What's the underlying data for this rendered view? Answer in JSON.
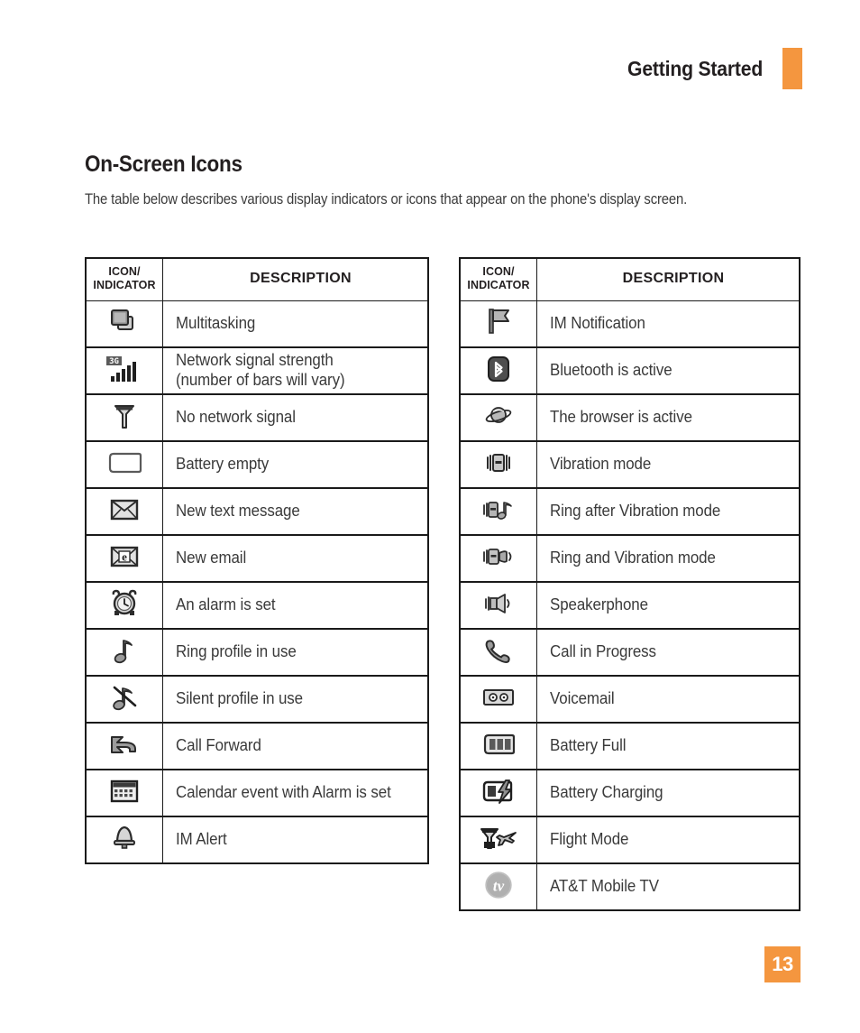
{
  "header": {
    "title": "Getting Started",
    "accent_color": "#f4963f"
  },
  "section": {
    "title": "On-Screen Icons",
    "intro": "The table below describes various display indicators or icons that appear on the phone's display screen."
  },
  "table_headers": {
    "icon": "ICON/\nINDICATOR",
    "icon_line1": "ICON/",
    "icon_line2": "INDICATOR",
    "description": "DESCRIPTION"
  },
  "left_table": {
    "rows": [
      {
        "icon": "multitasking-windows-icon",
        "description": "Multitasking"
      },
      {
        "icon": "network-signal-3g-bars-icon",
        "description": "Network signal strength\n(number of bars will vary)",
        "line1": "Network signal strength",
        "line2": "(number of bars will vary)"
      },
      {
        "icon": "no-network-antenna-icon",
        "description": "No network signal"
      },
      {
        "icon": "battery-empty-icon",
        "description": "Battery empty"
      },
      {
        "icon": "new-text-message-envelope-icon",
        "description": "New text message"
      },
      {
        "icon": "new-email-envelope-e-icon",
        "description": "New email"
      },
      {
        "icon": "alarm-clock-icon",
        "description": "An alarm is set"
      },
      {
        "icon": "music-note-icon",
        "description": "Ring profile in use"
      },
      {
        "icon": "music-note-muted-icon",
        "description": "Silent profile in use"
      },
      {
        "icon": "call-forward-arrow-icon",
        "description": "Call Forward"
      },
      {
        "icon": "calendar-icon",
        "description": "Calendar event with Alarm is set"
      },
      {
        "icon": "bell-icon",
        "description": "IM Alert"
      }
    ]
  },
  "right_table": {
    "rows": [
      {
        "icon": "flag-icon",
        "description": "IM Notification"
      },
      {
        "icon": "bluetooth-icon",
        "description": "Bluetooth is active"
      },
      {
        "icon": "browser-globe-icon",
        "description": "The browser is active"
      },
      {
        "icon": "vibration-phone-icon",
        "description": "Vibration mode"
      },
      {
        "icon": "ring-after-vibration-icon",
        "description": "Ring after Vibration mode"
      },
      {
        "icon": "ring-and-vibration-icon",
        "description": "Ring and Vibration mode"
      },
      {
        "icon": "speakerphone-icon",
        "description": "Speakerphone"
      },
      {
        "icon": "call-in-progress-handset-icon",
        "description": "Call in Progress"
      },
      {
        "icon": "voicemail-tape-icon",
        "description": "Voicemail"
      },
      {
        "icon": "battery-full-icon",
        "description": "Battery Full"
      },
      {
        "icon": "battery-charging-icon",
        "description": "Battery Charging"
      },
      {
        "icon": "flight-mode-plane-icon",
        "description": "Flight Mode"
      },
      {
        "icon": "att-mobile-tv-icon",
        "description": "AT&T Mobile TV"
      }
    ]
  },
  "footer": {
    "page_number": "13",
    "badge_color": "#f4963f"
  }
}
